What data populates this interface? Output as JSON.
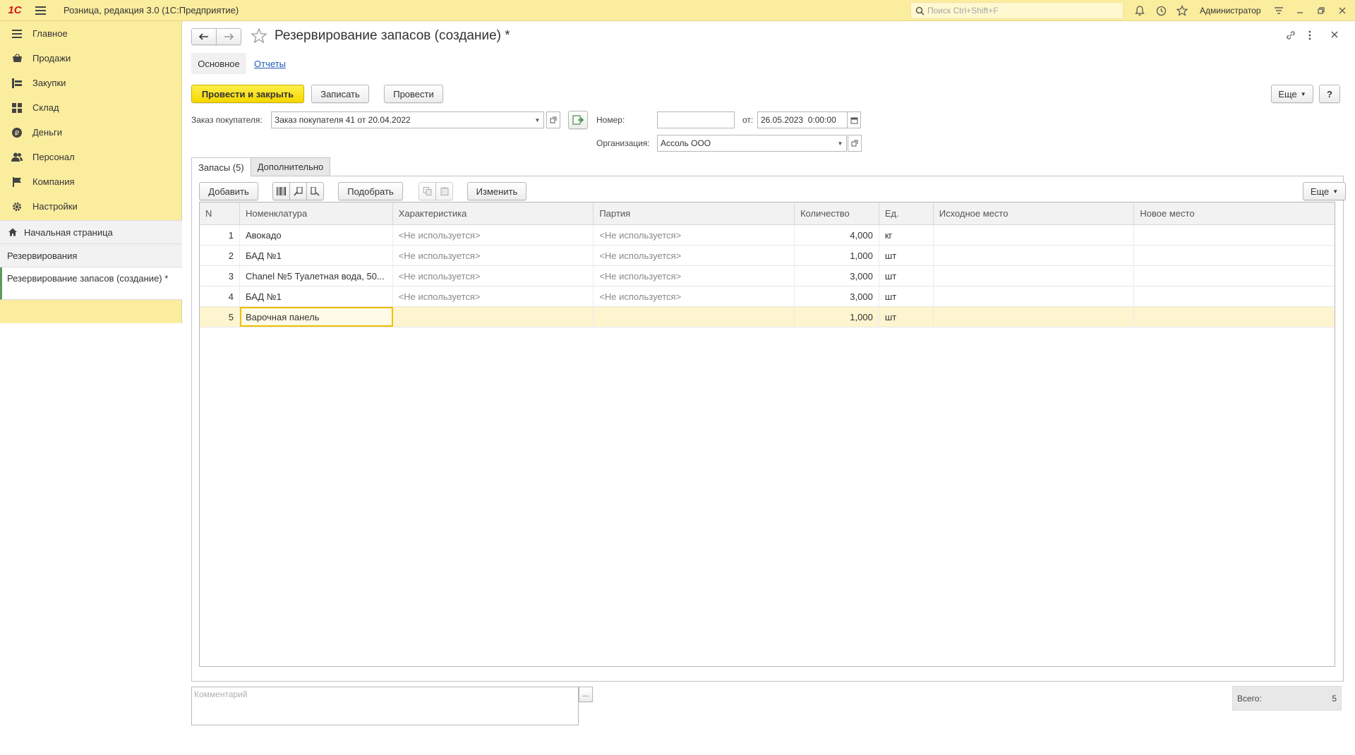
{
  "window": {
    "app_title": "Розница, редакция 3.0  (1С:Предприятие)",
    "search_placeholder": "Поиск Ctrl+Shift+F",
    "user": "Администратор",
    "logo_text": "1С"
  },
  "sidebar": {
    "items": [
      {
        "label": "Главное",
        "icon": "menu-icon"
      },
      {
        "label": "Продажи",
        "icon": "basket-icon"
      },
      {
        "label": "Закупки",
        "icon": "purchases-icon"
      },
      {
        "label": "Склад",
        "icon": "warehouse-icon"
      },
      {
        "label": "Деньги",
        "icon": "ruble-icon"
      },
      {
        "label": "Персонал",
        "icon": "people-icon"
      },
      {
        "label": "Компания",
        "icon": "flag-icon"
      },
      {
        "label": "Настройки",
        "icon": "gear-icon"
      }
    ],
    "open_windows": {
      "home": "Начальная страница",
      "reservations": "Резервирования",
      "active": "Резервирование запасов (создание) *"
    }
  },
  "form": {
    "title": "Резервирование запасов (создание) *",
    "tabs": {
      "main": "Основное",
      "reports": "Отчеты"
    },
    "buttons": {
      "post_close": "Провести и закрыть",
      "save": "Записать",
      "post": "Провести",
      "more": "Еще",
      "help": "?"
    },
    "fields": {
      "order_label": "Заказ покупателя:",
      "order_value": "Заказ покупателя 41 от 20.04.2022",
      "number_label": "Номер:",
      "number_value": "",
      "date_label": "от:",
      "date_value": "26.05.2023  0:00:00",
      "org_label": "Организация:",
      "org_value": "Ассоль ООО"
    },
    "inner_tabs": {
      "stocks": "Запасы (5)",
      "extra": "Дополнительно"
    },
    "table_toolbar": {
      "add": "Добавить",
      "pick": "Подобрать",
      "change": "Изменить",
      "more": "Еще"
    },
    "table": {
      "headers": [
        "N",
        "Номенклатура",
        "Характеристика",
        "Партия",
        "Количество",
        "Ед.",
        "Исходное место",
        "Новое место"
      ],
      "rows": [
        {
          "n": "1",
          "item": "Авокадо",
          "char": "<Не используется>",
          "batch": "<Не используется>",
          "qty": "4,000",
          "unit": "кг",
          "src": "",
          "dst": ""
        },
        {
          "n": "2",
          "item": "БАД №1",
          "char": "<Не используется>",
          "batch": "<Не используется>",
          "qty": "1,000",
          "unit": "шт",
          "src": "",
          "dst": ""
        },
        {
          "n": "3",
          "item": "Chanel №5 Туалетная вода, 50...",
          "char": "<Не используется>",
          "batch": "<Не используется>",
          "qty": "3,000",
          "unit": "шт",
          "src": "",
          "dst": ""
        },
        {
          "n": "4",
          "item": "БАД №1",
          "char": "<Не используется>",
          "batch": "<Не используется>",
          "qty": "3,000",
          "unit": "шт",
          "src": "",
          "dst": ""
        },
        {
          "n": "5",
          "item": "Варочная панель",
          "char": "",
          "batch": "",
          "qty": "1,000",
          "unit": "шт",
          "src": "",
          "dst": ""
        }
      ]
    },
    "comment_placeholder": "Комментарий",
    "total_label": "Всего:",
    "total_value": "5"
  }
}
